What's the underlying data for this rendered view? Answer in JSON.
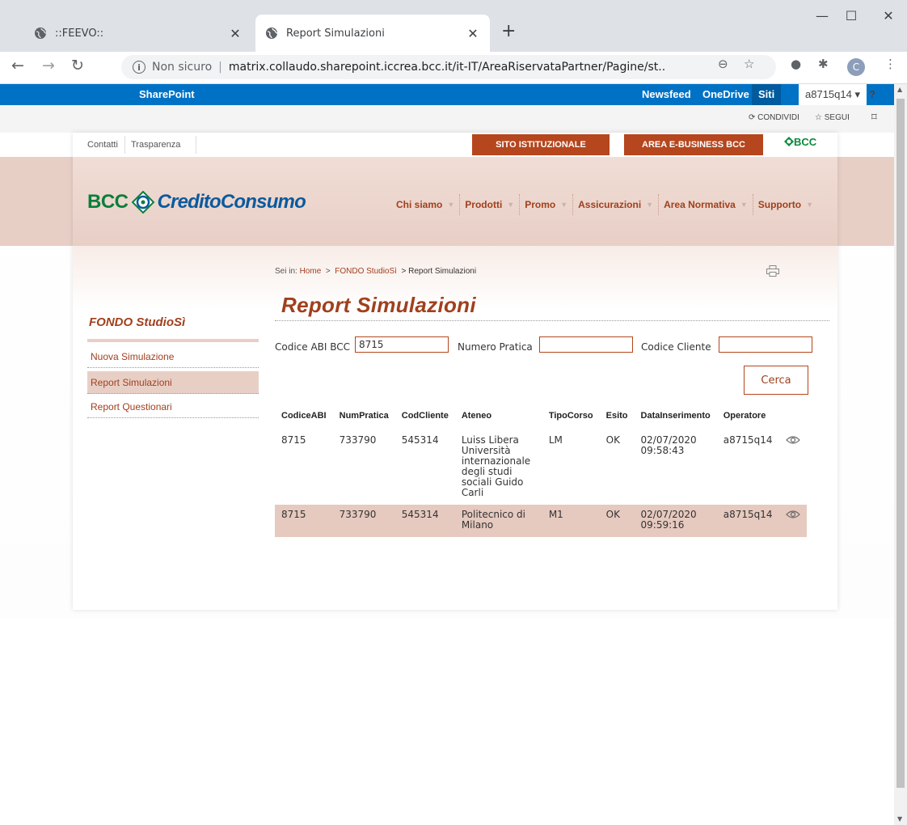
{
  "browser": {
    "tabs": [
      {
        "title": "::FEEVO::",
        "active": false
      },
      {
        "title": "Report Simulazioni",
        "active": true
      }
    ],
    "new_tab": "+",
    "window_controls": {
      "minimize": "—",
      "maximize": "☐",
      "close": "✕"
    },
    "address": {
      "security": "Non sicuro",
      "url": "matrix.collaudo.sharepoint.iccrea.bcc.it/it-IT/AreaRiservataPartner/Pagine/st..."
    },
    "profile_initial": "C"
  },
  "sharepoint": {
    "brand": "SharePoint",
    "links": [
      "Newsfeed",
      "OneDrive",
      "Siti"
    ],
    "user": "a8715q14 ▾",
    "help": "?",
    "actions": {
      "share": "CONDIVIDI",
      "follow": "SEGUI"
    }
  },
  "site": {
    "top_links": [
      "Contatti",
      "Trasparenza"
    ],
    "buttons": [
      "SITO ISTITUZIONALE",
      "AREA E-BUSINESS BCC"
    ],
    "bcc_mark": "BCC",
    "logo": {
      "bcc": "BCC",
      "brand": "CreditoConsumo"
    },
    "menu": [
      "Chi siamo",
      "Prodotti",
      "Promo",
      "Assicurazioni",
      "Area Normativa",
      "Supporto"
    ]
  },
  "breadcrumb": {
    "prefix": "Sei in:",
    "home": "Home",
    "sep1": ">",
    "section": "FONDO StudioSì",
    "current": "> Report Simulazioni"
  },
  "page": {
    "title": "Report Simulazioni"
  },
  "sidebar": {
    "title": "FONDO StudioSì",
    "items": [
      {
        "label": "Nuova Simulazione",
        "active": false
      },
      {
        "label": "Report Simulazioni",
        "active": true
      },
      {
        "label": "Report Questionari",
        "active": false
      }
    ]
  },
  "filters": {
    "abi_label": "Codice ABI BCC",
    "abi_value": "8715",
    "pratica_label": "Numero Pratica",
    "pratica_value": "",
    "cliente_label": "Codice Cliente",
    "cliente_value": "",
    "search_button": "Cerca"
  },
  "table": {
    "columns": [
      "CodiceABI",
      "NumPratica",
      "CodCliente",
      "Ateneo",
      "TipoCorso",
      "Esito",
      "DataInserimento",
      "Operatore"
    ],
    "rows": [
      {
        "abi": "8715",
        "pratica": "733790",
        "cliente": "545314",
        "ateneo": "Luiss Libera Università internazionale degli studi sociali Guido Carli",
        "corso": "LM",
        "esito": "OK",
        "data": "02/07/2020 09:58:43",
        "operatore": "a8715q14"
      },
      {
        "abi": "8715",
        "pratica": "733790",
        "cliente": "545314",
        "ateneo": "Politecnico di Milano",
        "corso": "M1",
        "esito": "OK",
        "data": "02/07/2020 09:59:16",
        "operatore": "a8715q14"
      }
    ]
  },
  "colors": {
    "brand_orange": "#b5461d",
    "link_brown": "#a0401d",
    "band": "#e8cfc6",
    "sharepoint_blue": "#0072c6"
  },
  "icons": [
    "globe-icon",
    "close-icon",
    "back-icon",
    "forward-icon",
    "reload-icon",
    "info-icon",
    "zoom-icon",
    "star-icon",
    "extension-icon",
    "print-icon",
    "eye-icon",
    "share-icon",
    "follow-star-icon",
    "focus-icon"
  ]
}
